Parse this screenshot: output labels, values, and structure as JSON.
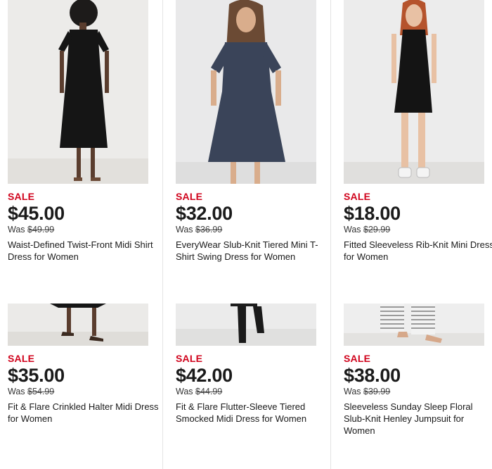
{
  "products": [
    {
      "sale": "SALE",
      "price": "$45.00",
      "was_label": "Was",
      "was_price": "$49.99",
      "name": "Waist-Defined Twist-Front Midi Shirt Dress for Women"
    },
    {
      "sale": "SALE",
      "price": "$32.00",
      "was_label": "Was",
      "was_price": "$36.99",
      "name": "EveryWear Slub-Knit Tiered Mini T-Shirt Swing Dress for Women"
    },
    {
      "sale": "SALE",
      "price": "$18.00",
      "was_label": "Was",
      "was_price": "$29.99",
      "name": "Fitted Sleeveless Rib-Knit Mini Dress for Women"
    },
    {
      "sale": "SALE",
      "price": "$35.00",
      "was_label": "Was",
      "was_price": "$54.99",
      "name": "Fit & Flare Crinkled Halter Midi Dress for Women"
    },
    {
      "sale": "SALE",
      "price": "$42.00",
      "was_label": "Was",
      "was_price": "$44.99",
      "name": "Fit & Flare Flutter-Sleeve Tiered Smocked Midi Dress for Women"
    },
    {
      "sale": "SALE",
      "price": "$38.00",
      "was_label": "Was",
      "was_price": "$39.99",
      "name": "Sleeveless Sunday Sleep Floral Slub-Knit Henley Jumpsuit for Women"
    }
  ],
  "colors": {
    "sale": "#d0021b",
    "text": "#1a1a1a",
    "photo_bg": "#efefee"
  }
}
